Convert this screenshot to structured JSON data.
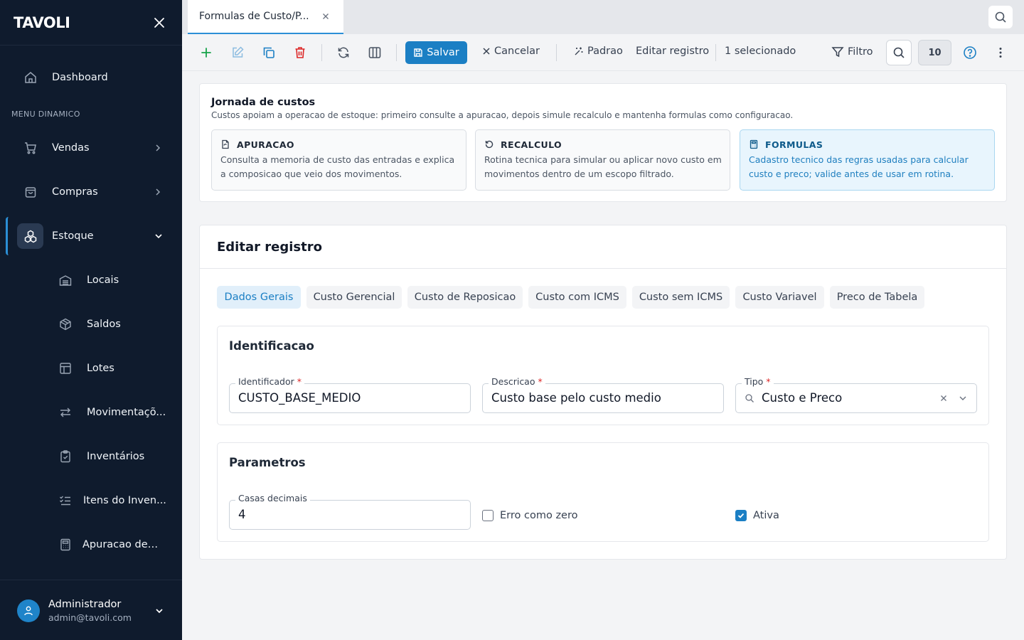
{
  "app": {
    "logo": "TAVOLI"
  },
  "sidebar": {
    "section_label": "MENU DINAMICO",
    "items": [
      {
        "label": "Dashboard",
        "icon": "home-icon"
      },
      {
        "label": "Vendas",
        "icon": "cart-icon"
      },
      {
        "label": "Compras",
        "icon": "bag-icon"
      },
      {
        "label": "Estoque",
        "icon": "boxes-icon"
      }
    ],
    "subitems": [
      {
        "label": "Locais",
        "icon": "building-icon"
      },
      {
        "label": "Saldos",
        "icon": "package-icon"
      },
      {
        "label": "Lotes",
        "icon": "layout-icon"
      },
      {
        "label": "Movimentaçõ...",
        "icon": "arrows-icon"
      },
      {
        "label": "Inventários",
        "icon": "clipboard-icon"
      },
      {
        "label": "Itens do Inven...",
        "icon": "list-check-icon"
      },
      {
        "label": "Apuracao de ...",
        "icon": "calculator-icon"
      }
    ],
    "user": {
      "name": "Administrador",
      "email": "admin@tavoli.com"
    }
  },
  "tabs": {
    "active_label": "Formulas de Custo/P..."
  },
  "toolbar": {
    "save_label": "Salvar",
    "cancel_label": "Cancelar",
    "default_label": "Padrao",
    "edit_label": "Editar registro",
    "selected_label": "1 selecionado",
    "filter_label": "Filtro",
    "page_size": "10"
  },
  "journey": {
    "title": "Jornada de custos",
    "subtitle": "Custos apoiam a operacao de estoque: primeiro consulte a apuracao, depois simule recalculo e mantenha formulas como configuracao.",
    "cards": [
      {
        "title": "APURACAO",
        "desc": "Consulta a memoria de custo das entradas e explica a composicao que veio dos movimentos."
      },
      {
        "title": "RECALCULO",
        "desc": "Rotina tecnica para simular ou aplicar novo custo em movimentos dentro de um escopo filtrado."
      },
      {
        "title": "FORMULAS",
        "desc": "Cadastro tecnico das regras usadas para calcular custo e preco; valide antes de usar em rotina."
      }
    ]
  },
  "edit": {
    "title": "Editar registro",
    "subtabs": [
      "Dados Gerais",
      "Custo Gerencial",
      "Custo de Reposicao",
      "Custo com ICMS",
      "Custo sem ICMS",
      "Custo Variavel",
      "Preco de Tabela"
    ],
    "identificacao": {
      "title": "Identificacao",
      "identificador_label": "Identificador",
      "identificador_value": "CUSTO_BASE_MEDIO",
      "descricao_label": "Descricao",
      "descricao_value": "Custo base pelo custo medio",
      "tipo_label": "Tipo",
      "tipo_value": "Custo e Preco"
    },
    "parametros": {
      "title": "Parametros",
      "casas_label": "Casas decimais",
      "casas_value": "4",
      "erro_label": "Erro como zero",
      "erro_checked": false,
      "ativa_label": "Ativa",
      "ativa_checked": true
    },
    "required_mark": "*"
  },
  "colors": {
    "accent": "#1b7fc4",
    "sidebar_bg": "#0f1b2d",
    "success": "#16a34a",
    "danger": "#dc2626"
  }
}
